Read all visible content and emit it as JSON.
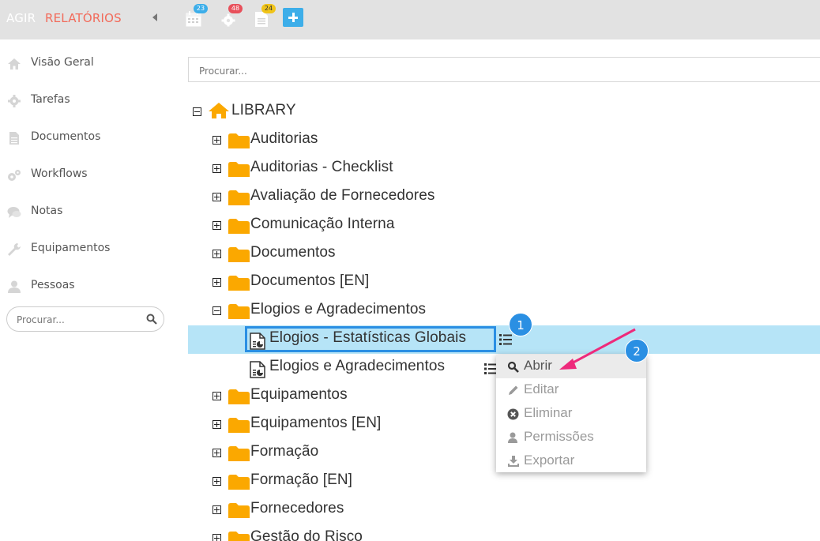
{
  "topbar": {
    "brand": "AGIR",
    "section": "RELATÓRIOS",
    "badges": {
      "calendar": "23",
      "gear": "48",
      "docs": "24"
    },
    "colors": {
      "calendar": "#3daee9",
      "gear": "#e8505b",
      "docs": "#f0c419",
      "plus": "#3daee9"
    }
  },
  "sidebar": {
    "items": [
      {
        "label": "Visão Geral",
        "icon": "home-icon"
      },
      {
        "label": "Tarefas",
        "icon": "gear-icon"
      },
      {
        "label": "Documentos",
        "icon": "document-icon"
      },
      {
        "label": "Workflows",
        "icon": "gears-icon"
      },
      {
        "label": "Notas",
        "icon": "comments-icon"
      },
      {
        "label": "Equipamentos",
        "icon": "wrench-icon"
      },
      {
        "label": "Pessoas",
        "icon": "user-icon"
      }
    ],
    "search_placeholder": "Procurar..."
  },
  "main": {
    "search_placeholder": "Procurar...",
    "root": "LIBRARY",
    "folders_top": [
      "Auditorias",
      "Auditorias - Checklist",
      "Avaliação de Fornecedores",
      "Comunicação Interna",
      "Documentos",
      "Documentos [EN]"
    ],
    "expanded_folder": "Elogios e Agradecimentos",
    "reports": [
      "Elogios - Estatísticas Globais",
      "Elogios e Agradecimentos"
    ],
    "folders_bottom": [
      "Equipamentos",
      "Equipamentos [EN]",
      "Formação",
      "Formação [EN]",
      "Fornecedores",
      "Gestão do Risco"
    ]
  },
  "context_menu": {
    "items": [
      "Abrir",
      "Editar",
      "Eliminar",
      "Permissões",
      "Exportar"
    ]
  },
  "callouts": {
    "one": "1",
    "two": "2"
  },
  "colors": {
    "folder": "#fba800",
    "selected_row": "#b6e4f7",
    "accent": "#2a8fe3",
    "arrow": "#ee2a7b"
  }
}
